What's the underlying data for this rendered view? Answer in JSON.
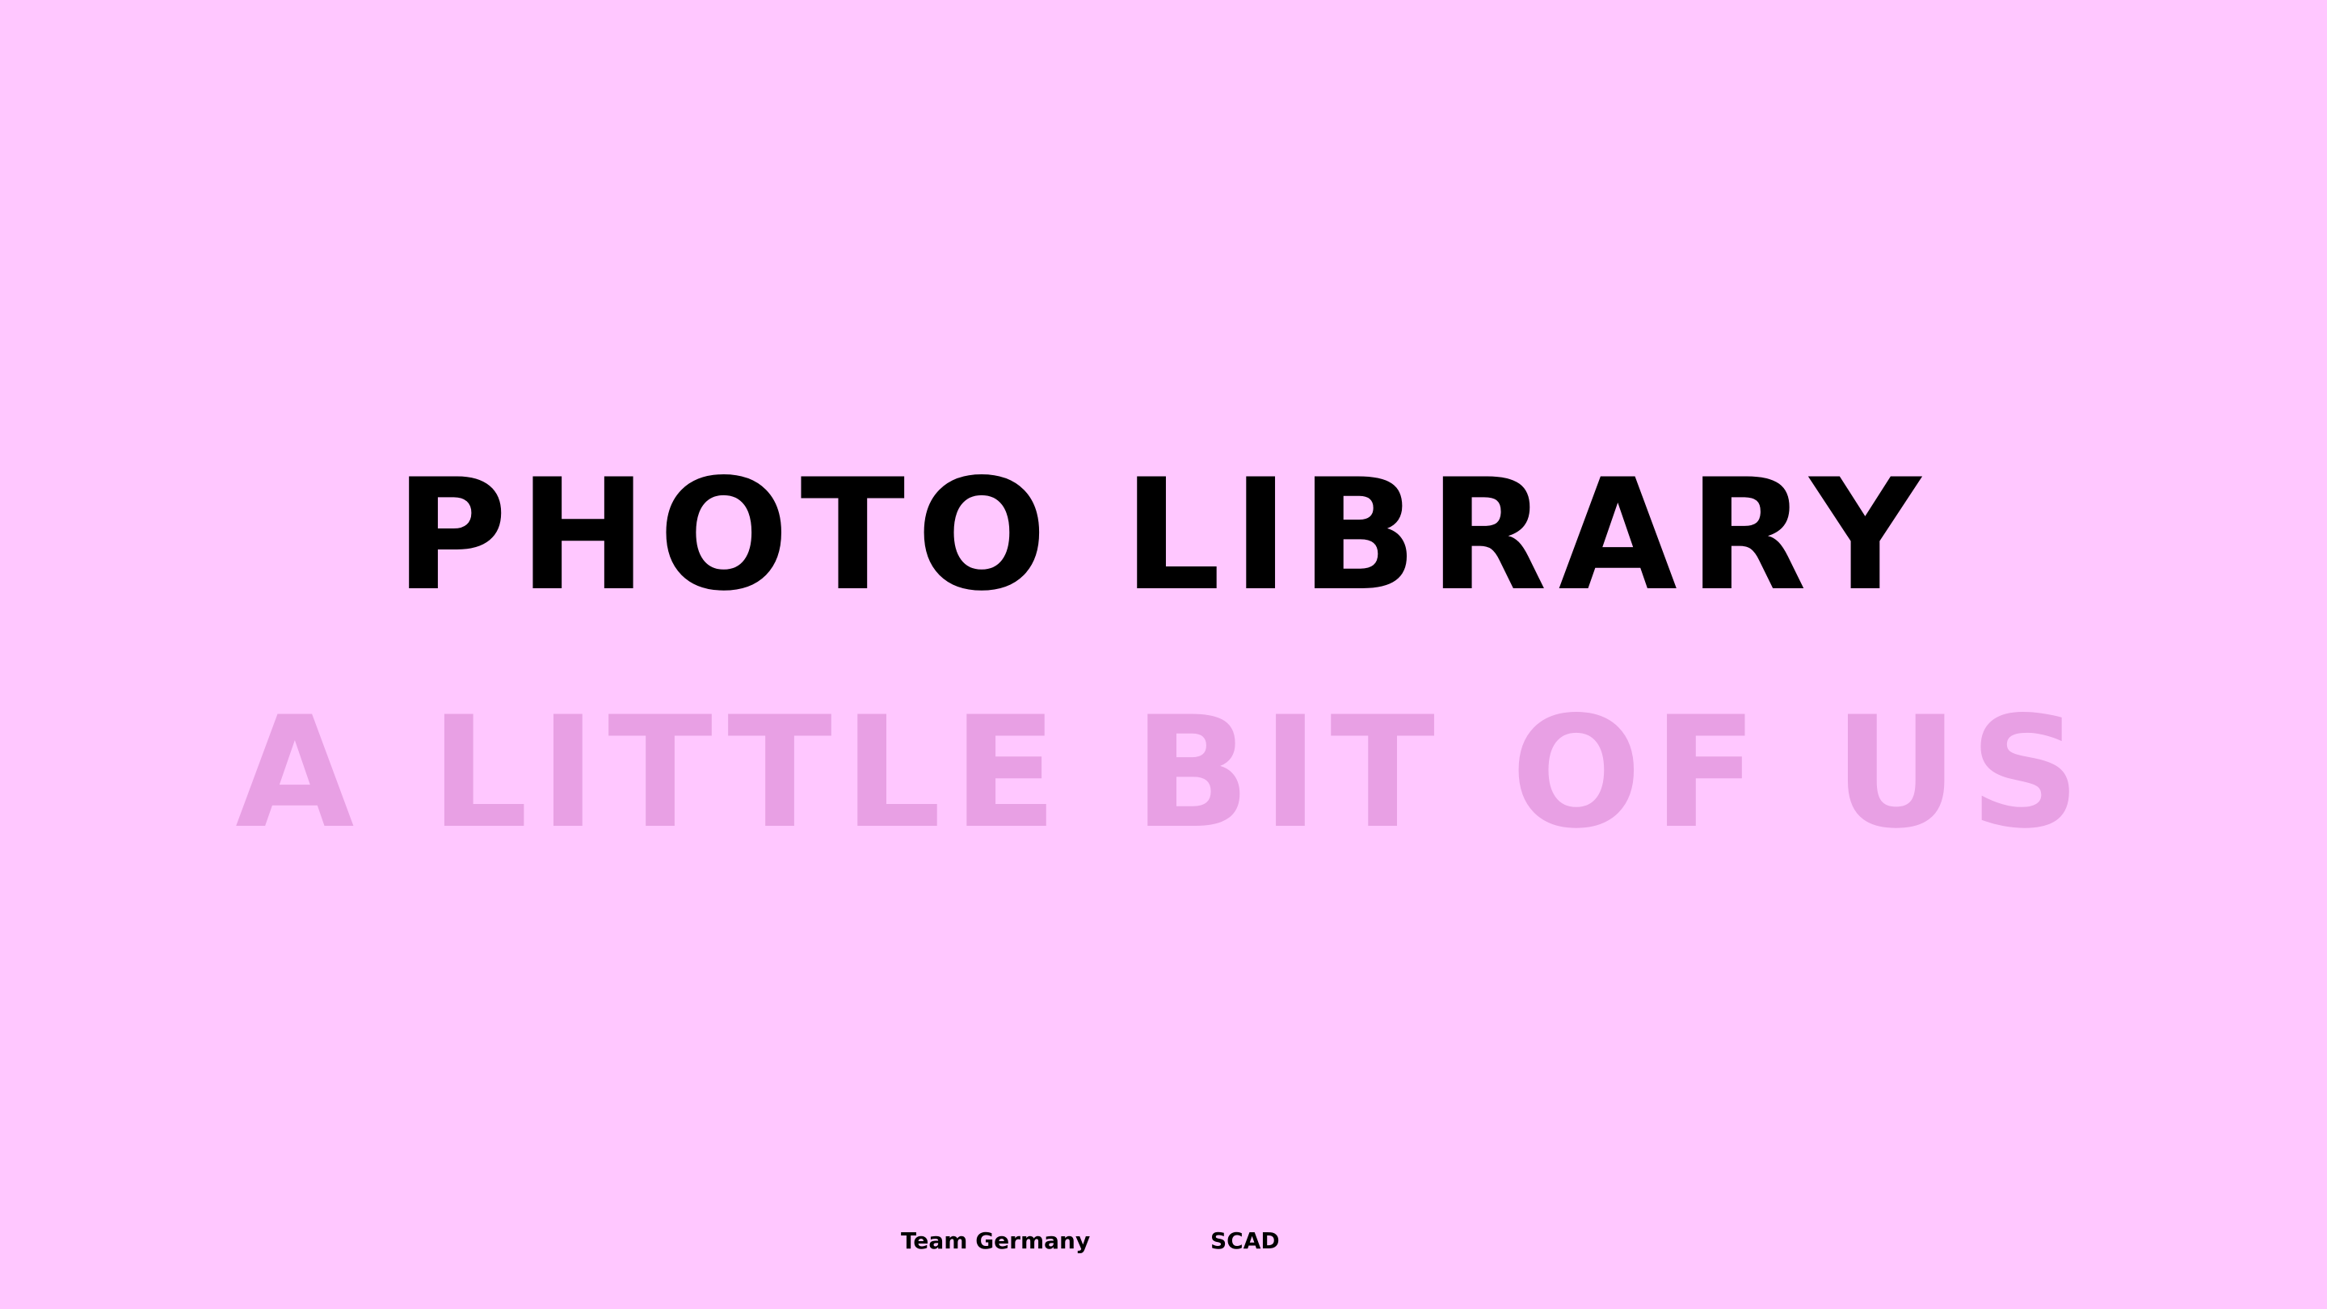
{
  "slide": {
    "title": "PHOTO LIBRARY",
    "subtitle": "A LITTLE BIT OF US",
    "footer_left": "Team Germany",
    "footer_right": "SCAD"
  },
  "colors": {
    "background": "#ffc7ff",
    "title": "#000000",
    "subtitle": "#e8a0e4",
    "footer": "#000000"
  }
}
